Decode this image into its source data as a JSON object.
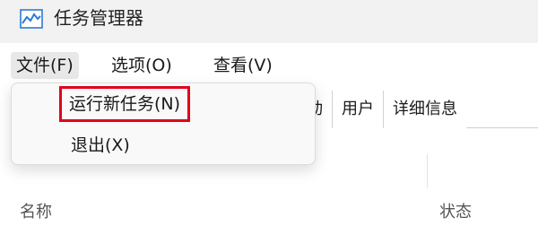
{
  "window": {
    "title": "任务管理器",
    "icon": "task-manager-graph-icon"
  },
  "menubar": {
    "items": [
      {
        "label": "文件(F)"
      },
      {
        "label": "选项(O)"
      },
      {
        "label": "查看(V)"
      }
    ]
  },
  "file_menu": {
    "items": [
      {
        "label": "运行新任务(N)",
        "highlighted": true
      },
      {
        "label": "退出(X)"
      }
    ],
    "highlight_color": "#e3001b"
  },
  "tabs": {
    "items": [
      {
        "label": "动"
      },
      {
        "label": "用户"
      },
      {
        "label": "详细信息"
      }
    ]
  },
  "columns": {
    "name": "名称",
    "status": "状态"
  }
}
